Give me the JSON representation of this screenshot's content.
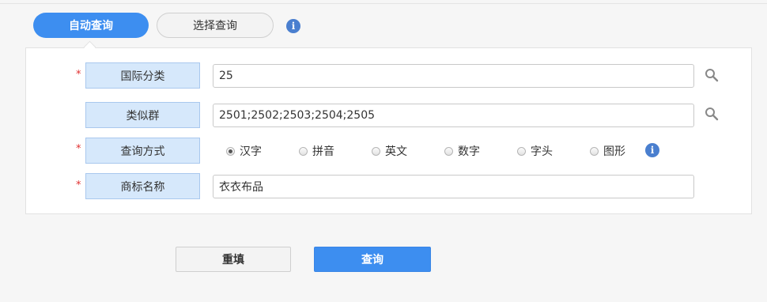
{
  "tabs": [
    {
      "label": "自动查询",
      "active": true
    },
    {
      "label": "选择查询",
      "active": false
    }
  ],
  "form": {
    "required_mark": "*",
    "intl_class": {
      "label": "国际分类",
      "value": "25"
    },
    "similar_group": {
      "label": "类似群",
      "value": "2501;2502;2503;2504;2505"
    },
    "query_method": {
      "label": "查询方式",
      "options": [
        "汉字",
        "拼音",
        "英文",
        "数字",
        "字头",
        "图形"
      ],
      "selected": "汉字"
    },
    "trademark_name": {
      "label": "商标名称",
      "value": "衣衣布品"
    }
  },
  "icons": {
    "info": "i",
    "search": "search-icon"
  },
  "buttons": {
    "reset": "重填",
    "query": "查询"
  },
  "colors": {
    "accent": "#3d8ef0",
    "label_bg": "#d6e8fb",
    "required": "#e03030",
    "info": "#4a7fcf"
  }
}
